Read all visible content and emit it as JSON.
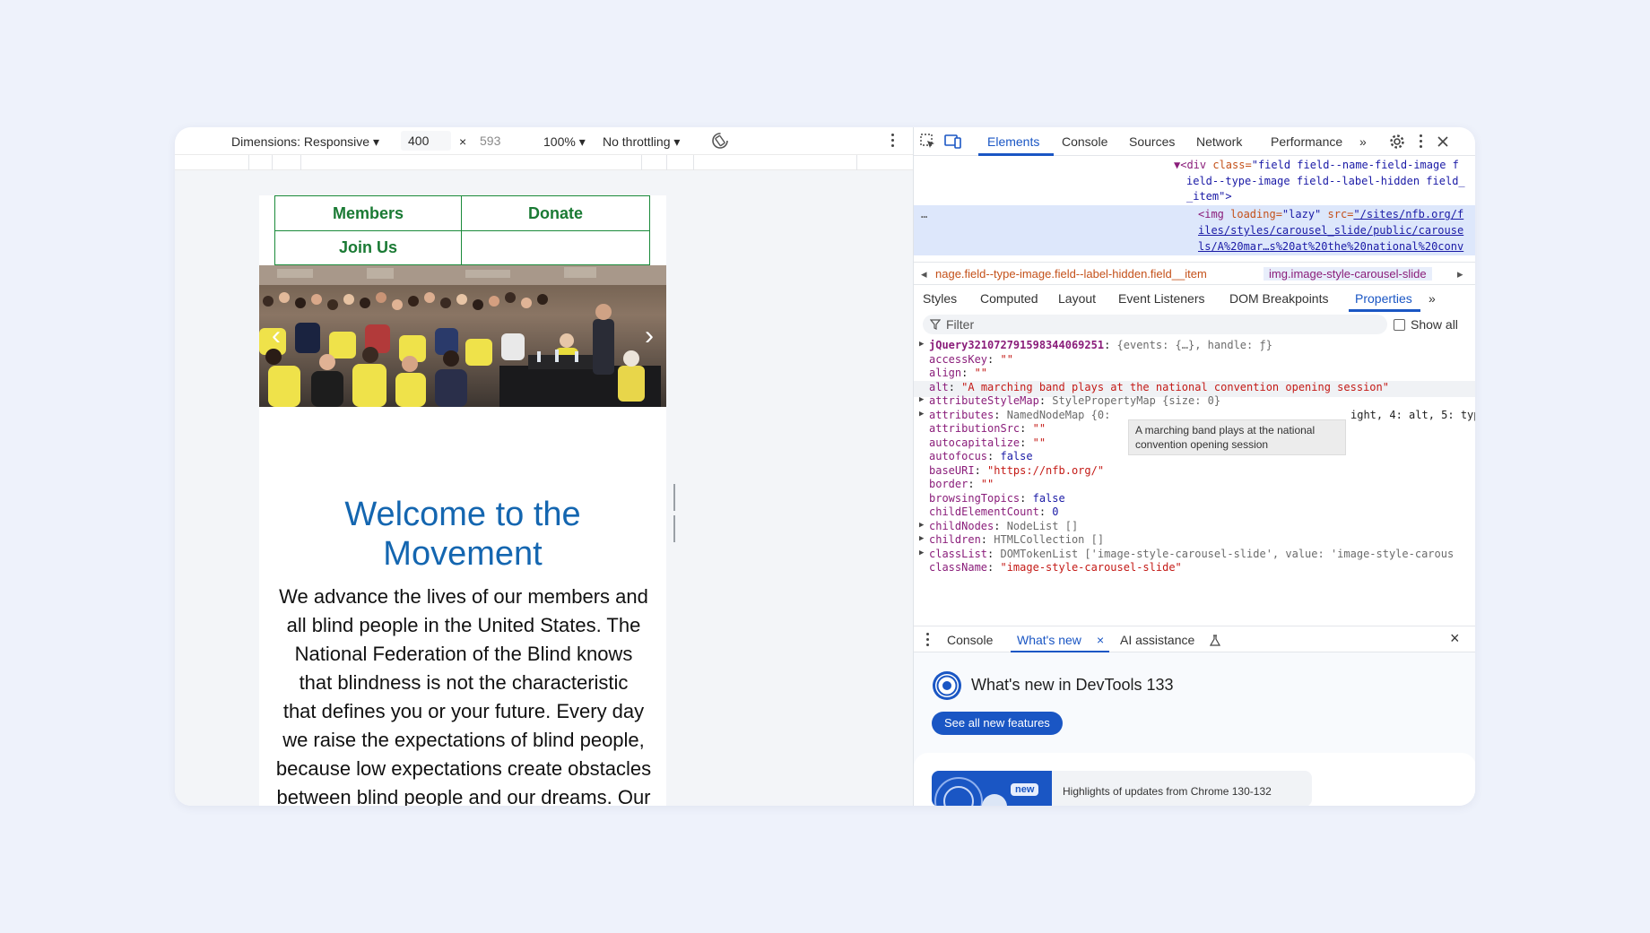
{
  "device_toolbar": {
    "dimensions_label": "Dimensions: Responsive ▾",
    "width": "400",
    "times": "×",
    "height": "593",
    "zoom": "100% ▾",
    "throttling": "No throttling ▾"
  },
  "emulated_page": {
    "nav": {
      "members": "Members",
      "donate": "Donate",
      "join": "Join Us"
    },
    "carousel_prev": "‹",
    "carousel_next": "›",
    "welcome_line1": "Welcome to the",
    "welcome_line2": "Movement",
    "body_lines": [
      "We advance the lives of our members and",
      "all blind people in the United States. The",
      "National Federation of the Blind knows",
      "that blindness is not the characteristic",
      "that defines you or your future. Every day",
      "we raise the expectations of blind people,",
      "because low expectations create obstacles",
      "between blind people and our dreams. Our"
    ]
  },
  "devtools": {
    "tabs": [
      "Elements",
      "Console",
      "Sources",
      "Network",
      "Performance"
    ],
    "more_tabs": "»",
    "dom": {
      "line1_tag_open": "▼<div ",
      "line1_attr": "class=",
      "line1_value": "\"field field--name-field-image f",
      "line2": "ield--type-image field--label-hidden field_",
      "line3": "_item\">",
      "dots": "…",
      "img_open": "<img ",
      "img_attr1": "loading=",
      "img_val1": "\"lazy\" ",
      "img_attr2": "src=",
      "img_src1": "\"/sites/nfb.org/f",
      "img_src2": "iles/styles/carousel_slide/public/carouse",
      "img_src3": "ls/A%20mar…s%20at%20the%20national%20conv"
    },
    "breadcrumb": {
      "left_arrow": "◂",
      "crumb1": "nage.field--type-image.field--label-hidden.field__item",
      "crumb2": "img.image-style-carousel-slide",
      "right_arrow": "▸"
    },
    "subtabs": [
      "Styles",
      "Computed",
      "Layout",
      "Event Listeners",
      "DOM Breakpoints",
      "Properties"
    ],
    "subtabs_more": "»",
    "filter_placeholder": "Filter",
    "show_all": "Show all",
    "properties": [
      {
        "key": "jQuery3210727915983440692​51",
        "sep": ": ",
        "val": "{events: {…}, handle: ƒ}",
        "kind": "gray",
        "expand": true,
        "bold": true
      },
      {
        "key": "accessKey",
        "sep": ": ",
        "val": "\"\"",
        "kind": "str"
      },
      {
        "key": "align",
        "sep": ": ",
        "val": "\"\"",
        "kind": "str"
      },
      {
        "key": "alt",
        "sep": ": ",
        "val": "\"A marching band plays at the national convention opening session\"",
        "kind": "str",
        "highlight": true
      },
      {
        "key": "attributeStyleMap",
        "sep": ": ",
        "val": "StylePropertyMap {size: 0}",
        "kind": "gray",
        "expand": true
      },
      {
        "key": "attributes",
        "sep": ": ",
        "val": "NamedNodeMap {0:",
        "kind": "gray",
        "expand": true,
        "tail": "ight, 4: alt, 5: typ"
      },
      {
        "key": "attributionSrc",
        "sep": ": ",
        "val": "\"\"",
        "kind": "str"
      },
      {
        "key": "autocapitalize",
        "sep": ": ",
        "val": "\"\"",
        "kind": "str"
      },
      {
        "key": "autofocus",
        "sep": ": ",
        "val": "false",
        "kind": "kw"
      },
      {
        "key": "baseURI",
        "sep": ": ",
        "val": "\"https://nfb.org/\"",
        "kind": "str"
      },
      {
        "key": "border",
        "sep": ": ",
        "val": "\"\"",
        "kind": "str"
      },
      {
        "key": "browsingTopics",
        "sep": ": ",
        "val": "false",
        "kind": "kw"
      },
      {
        "key": "childElementCount",
        "sep": ": ",
        "val": "0",
        "kind": "kw"
      },
      {
        "key": "childNodes",
        "sep": ": ",
        "val": "NodeList []",
        "kind": "gray",
        "expand": true
      },
      {
        "key": "children",
        "sep": ": ",
        "val": "HTMLCollection []",
        "kind": "gray",
        "expand": true
      },
      {
        "key": "classList",
        "sep": ": ",
        "val": "DOMTokenList ['image-style-carousel-slide', value: 'image-style-carous",
        "kind": "gray",
        "expand": true
      },
      {
        "key": "className",
        "sep": ": ",
        "val": "\"image-style-carousel-slide\"",
        "kind": "str"
      }
    ],
    "tooltip": "A marching band plays at the national convention opening session",
    "drawer": {
      "tabs": [
        "Console",
        "What's new",
        "AI assistance"
      ],
      "close_tab": "×",
      "close": "×"
    },
    "whats_new_title": "What's new in DevTools 133",
    "see_all_button": "See all new features",
    "highlight_badge": "new",
    "highlight_text": "Highlights of updates from Chrome 130-132"
  },
  "colors": {
    "accent": "#1a56c4",
    "nfb_green": "#1a7a34",
    "nfb_blue": "#1466b0"
  }
}
